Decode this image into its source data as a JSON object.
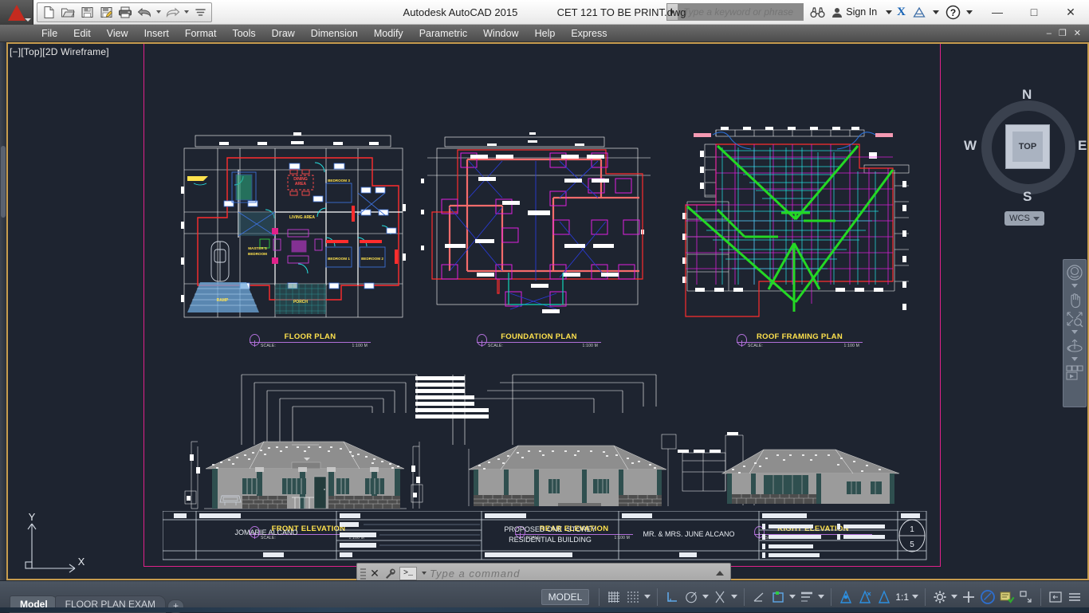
{
  "window": {
    "app_title": "Autodesk AutoCAD 2015",
    "file_name": "CET 121 TO BE PRINT.dwg",
    "minimize": "—",
    "maximize": "□",
    "close": "✕",
    "doc_minimize": "–",
    "doc_restore": "❐",
    "doc_close": "✕"
  },
  "quick_access": {
    "items": [
      {
        "name": "new-icon",
        "label": "New"
      },
      {
        "name": "open-icon",
        "label": "Open"
      },
      {
        "name": "save-icon",
        "label": "Save"
      },
      {
        "name": "save-as-icon",
        "label": "Save As"
      },
      {
        "name": "plot-icon",
        "label": "Plot"
      },
      {
        "name": "undo-icon",
        "label": "Undo"
      },
      {
        "name": "redo-icon",
        "label": "Redo"
      },
      {
        "name": "qat-more-icon",
        "label": "Customize Quick Access Toolbar"
      }
    ]
  },
  "infocenter": {
    "search_placeholder": "Type a keyword or phrase",
    "search_value": "",
    "search_icon": "binoculars-icon",
    "sign_in_label": "Sign In",
    "account_icon": "user-icon",
    "exchange_label": "X",
    "autodesk_icon": "autodesk-a360-icon",
    "help_label": "?"
  },
  "menubar": {
    "items": [
      {
        "label": "File"
      },
      {
        "label": "Edit"
      },
      {
        "label": "View"
      },
      {
        "label": "Insert"
      },
      {
        "label": "Format"
      },
      {
        "label": "Tools"
      },
      {
        "label": "Draw"
      },
      {
        "label": "Dimension"
      },
      {
        "label": "Modify"
      },
      {
        "label": "Parametric"
      },
      {
        "label": "Window"
      },
      {
        "label": "Help"
      },
      {
        "label": "Express"
      }
    ]
  },
  "viewport": {
    "label": "[−][Top][2D Wireframe]",
    "viewcube": {
      "north": "N",
      "south": "S",
      "east": "E",
      "west": "W",
      "face": "TOP",
      "ucs_label": "WCS"
    },
    "navbar": [
      {
        "name": "steering-wheels-icon"
      },
      {
        "name": "pan-icon"
      },
      {
        "name": "zoom-extents-icon"
      },
      {
        "name": "orbit-icon"
      },
      {
        "name": "showmotion-icon"
      }
    ],
    "ucs_icon": {
      "y_label": "Y",
      "x_label": "X"
    }
  },
  "drawing": {
    "plans": [
      {
        "name": "FLOOR PLAN",
        "scale_label": "SCALE:",
        "scale_value": "1:100 M"
      },
      {
        "name": "FOUNDATION PLAN",
        "scale_label": "SCALE:",
        "scale_value": "1:100 M"
      },
      {
        "name": "ROOF FRAMING PLAN",
        "scale_label": "SCALE:",
        "scale_value": "1:100 M"
      }
    ],
    "elevations": [
      {
        "name": "FRONT ELEVATION",
        "scale_label": "SCALE:",
        "scale_value": "1:100 M"
      },
      {
        "name": "REAR ELEVATION",
        "scale_label": "SCALE:",
        "scale_value": "1:100 M"
      },
      {
        "name": "RIGHT ELEVATION",
        "scale_label": "SCALE:",
        "scale_value": "1:100 M"
      }
    ],
    "floor_plan_rooms": [
      {
        "label": "DINING AREA",
        "color": "#ff4d4d"
      },
      {
        "label": "LIVING AREA",
        "color": "#ffe24d"
      },
      {
        "label": "BEDROOM 3",
        "color": "#ffe24d"
      },
      {
        "label": "BEDROOM 1",
        "color": "#ffe24d"
      },
      {
        "label": "BEDROOM 2",
        "color": "#ffe24d"
      },
      {
        "label": "MASTER'S BEDROOM",
        "color": "#ffe24d"
      },
      {
        "label": "RAMP",
        "color": "#ffe24d"
      },
      {
        "label": "PORCH",
        "color": "#ffe24d"
      }
    ],
    "title_block": {
      "drawn_by": "JOMARIE ALCANO",
      "project_title": "PROPOSED ONE -STOREY",
      "project_title2": "RESIDENTIAL BUILDING",
      "owner": "MR. & MRS. JUNE ALCANO",
      "sheet_number": "1",
      "sheet_total": "5"
    }
  },
  "command_line": {
    "placeholder": "Type a command",
    "value": "",
    "close_icon": "close-icon",
    "settings_icon": "wrench-icon",
    "prompt_icon": "console-icon",
    "expand_icon": "chevron-up-icon"
  },
  "statusbar": {
    "tabs": [
      {
        "label": "Model",
        "active": true
      },
      {
        "label": "FLOOR PLAN EXAM",
        "active": false
      },
      {
        "label": "+",
        "active": false
      }
    ],
    "space_label": "MODEL",
    "scale_label": "1:1",
    "buttons": [
      {
        "name": "grid-display-icon"
      },
      {
        "name": "snap-mode-icon"
      },
      {
        "name": "ortho-mode-icon"
      },
      {
        "name": "polar-tracking-icon"
      },
      {
        "name": "object-snap-icon"
      },
      {
        "name": "object-snap-tracking-icon"
      },
      {
        "name": "dynamic-ucs-icon"
      },
      {
        "name": "lineweight-icon"
      },
      {
        "name": "annotation-visibility-icon"
      },
      {
        "name": "autoscale-icon"
      },
      {
        "name": "annotation-scale-icon"
      },
      {
        "name": "workspace-switching-icon"
      },
      {
        "name": "customization-icon"
      },
      {
        "name": "isolate-objects-icon"
      },
      {
        "name": "hardware-acceleration-icon"
      },
      {
        "name": "clean-screen-icon"
      },
      {
        "name": "fullscreen-icon"
      },
      {
        "name": "menu-icon"
      }
    ]
  },
  "colors": {
    "accent_pink": "#e0218a",
    "title_yellow": "#ffe24d",
    "canvas_bg": "#1e2430",
    "highlight_orange": "#c79c4e"
  }
}
